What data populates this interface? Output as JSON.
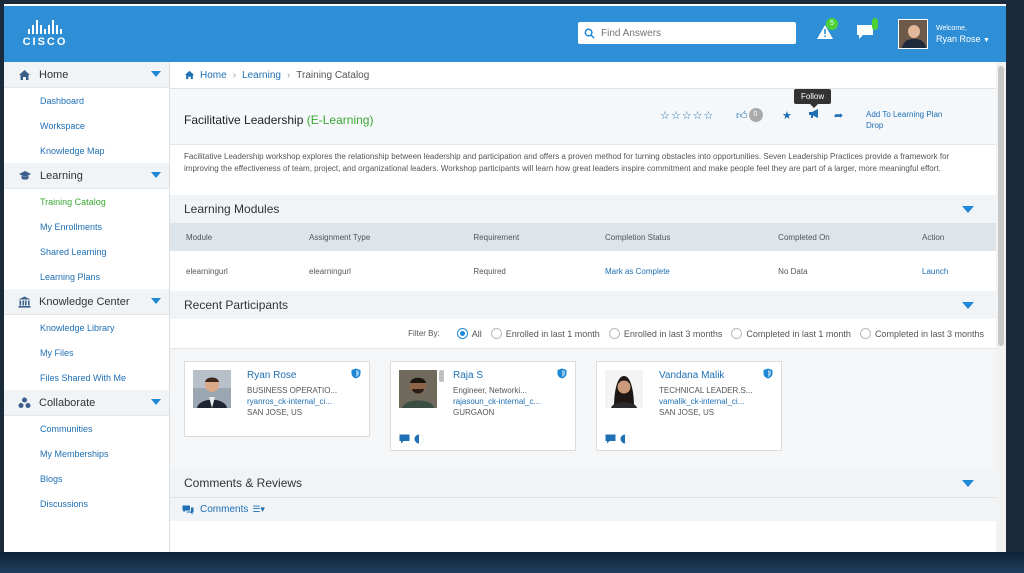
{
  "header": {
    "logo_text": "CISCO",
    "search_placeholder": "Find Answers",
    "alerts_count": "5",
    "messages_count": "0",
    "welcome": "Welcome,",
    "user_name": "Ryan Rose"
  },
  "sidebar": {
    "sections": [
      {
        "label": "Home",
        "items": [
          "Dashboard",
          "Workspace",
          "Knowledge Map"
        ]
      },
      {
        "label": "Learning",
        "items": [
          "Training Catalog",
          "My Enrollments",
          "Shared Learning",
          "Learning Plans"
        ]
      },
      {
        "label": "Knowledge Center",
        "items": [
          "Knowledge Library",
          "My Files",
          "Files Shared With Me"
        ]
      },
      {
        "label": "Collaborate",
        "items": [
          "Communities",
          "My Memberships",
          "Blogs",
          "Discussions"
        ]
      }
    ],
    "active_item": "Training Catalog"
  },
  "breadcrumb": {
    "home": "Home",
    "level1": "Learning",
    "current": "Training Catalog"
  },
  "course": {
    "title": "Facilitative Leadership",
    "type": "(E-Learning)",
    "likes": "0",
    "tooltip": "Follow",
    "add_plan_line1": "Add To Learning Plan",
    "add_plan_line2": "Drop",
    "description": "Facilitative Leadership workshop explores the relationship between leadership and participation and offers a proven method for turning obstacles into opportunities. Seven Leadership Practices provide a framework for improving the effectiveness of team, project, and organizational leaders. Workshop participants will learn how great leaders inspire commitment and make people feel they are part of a larger, more meaningful effort."
  },
  "modules": {
    "title": "Learning Modules",
    "columns": [
      "Module",
      "Assignment Type",
      "Requirement",
      "Completion Status",
      "Completed On",
      "Action"
    ],
    "rows": [
      [
        "elearningurl",
        "elearningurl",
        "Required",
        "Mark as Complete",
        "No Data",
        "Launch"
      ]
    ]
  },
  "participants": {
    "title": "Recent Participants",
    "filter_label": "Filter By:",
    "filters": [
      "All",
      "Enrolled in last 1 month",
      "Enrolled in last 3 months",
      "Completed in last 1 month",
      "Completed in last 3 months"
    ],
    "selected_filter": "All",
    "people": [
      {
        "name": "Ryan Rose",
        "title": "BUSINESS OPERATIO...",
        "email": "ryanros_ck-internal_ci...",
        "location": "SAN JOSE, US"
      },
      {
        "name": "Raja S",
        "title": "Engineer, Networki...",
        "email": "rajasoun_ck-internal_c...",
        "location": "GURGAON"
      },
      {
        "name": "Vandana Malik",
        "title": "TECHNICAL LEADER.S...",
        "email": "vamalik_ck-internal_ci...",
        "location": "SAN JOSE, US"
      }
    ]
  },
  "comments": {
    "title": "Comments & Reviews",
    "tab_label": "Comments"
  },
  "colors": {
    "header_blue": "#2e8fd6",
    "link_blue": "#1e6fb4",
    "active_green": "#3aa832"
  }
}
